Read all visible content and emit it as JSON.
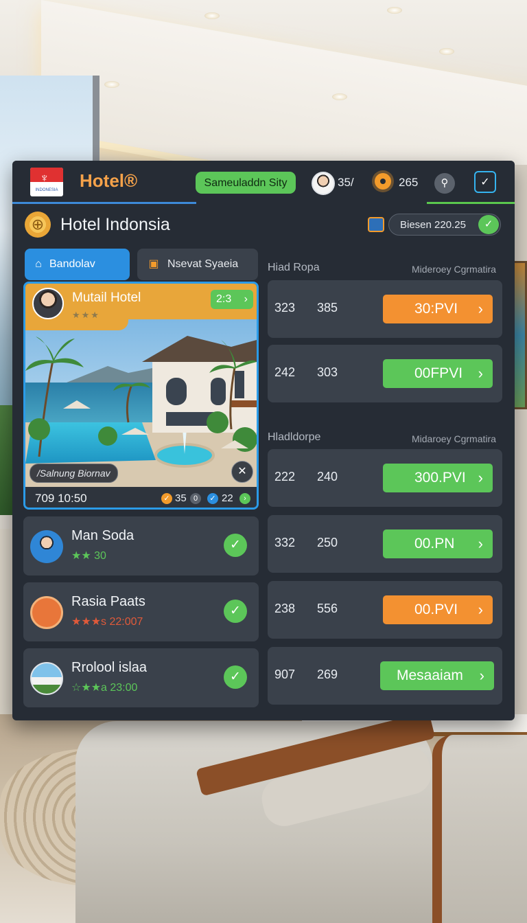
{
  "header": {
    "logo_text": "INDONESIA",
    "brand": "Hotel®",
    "city_button": "Sameuladdn Sity",
    "stat1": "35/",
    "stat2": "265",
    "icons": {
      "profile": "avatar",
      "settings": "gear-icon",
      "location": "pin-icon",
      "tasks": "checklist-icon"
    }
  },
  "title_row": {
    "title": "Hotel Indonsia",
    "search_text": "Biesen 220.25"
  },
  "tabs": [
    {
      "label": "Bandolav",
      "icon": "home-icon",
      "active": true
    },
    {
      "label": "Nsevat Syaeia",
      "icon": "calendar-icon",
      "active": false
    }
  ],
  "featured": {
    "name": "Mutail Hotel",
    "stars": "★★★",
    "badge": "2:3",
    "caption": "/Salnung Biornav",
    "time": "709 10:50",
    "count1": "35",
    "count2": "22"
  },
  "list": [
    {
      "title": "Man Soda",
      "sub": "★★ 30",
      "sub_color": "#5cc659",
      "icon": "person-icon"
    },
    {
      "title": "Rasia Paats",
      "sub": "★★★s 22:007",
      "sub_color": "#e05a3a",
      "icon": "door-icon"
    },
    {
      "title": "Rrolool islaa",
      "sub": "☆★★a 23:00",
      "sub_color": "#5cc659",
      "icon": "villa-photo-icon"
    }
  ],
  "sections": [
    {
      "label": "Hiad Ropa",
      "right": "Mideroey Cgrmatira"
    },
    {
      "label": "Hladldorpe",
      "right": "Midaroey Cgrmatira"
    }
  ],
  "rows": [
    {
      "a": "323",
      "b": "385",
      "btn": "30:PVI",
      "color": "orange"
    },
    {
      "a": "242",
      "b": "303",
      "btn": "00FPVI",
      "color": "green"
    },
    {
      "a": "222",
      "b": "240",
      "btn": "300.PVI",
      "color": "green"
    },
    {
      "a": "332",
      "b": "250",
      "btn": "00.PN",
      "color": "green"
    },
    {
      "a": "238",
      "b": "556",
      "btn": "00.PVI",
      "color": "orange"
    },
    {
      "a": "907",
      "b": "269",
      "btn": "Mesaaiam",
      "color": "green"
    }
  ],
  "colors": {
    "orange": "#f39131",
    "green": "#5cc659",
    "accent_blue": "#2b8fe0",
    "panel": "#262c35"
  }
}
